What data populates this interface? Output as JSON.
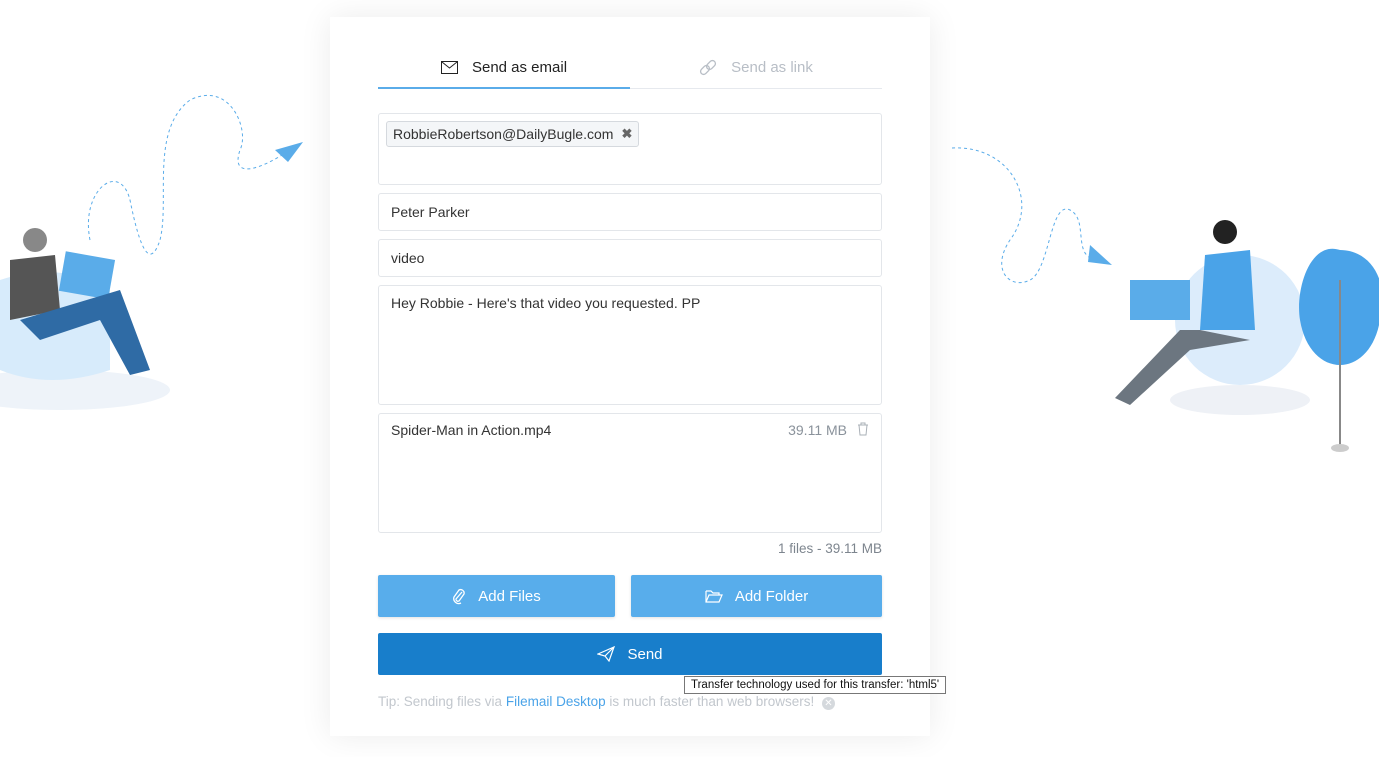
{
  "tabs": [
    {
      "label": "Send as email",
      "icon": "envelope-icon",
      "active": true
    },
    {
      "label": "Send as link",
      "icon": "link-icon",
      "active": false
    }
  ],
  "form": {
    "recipients": [
      "RobbieRobertson@DailyBugle.com"
    ],
    "from_name": "Peter Parker",
    "subject": "video",
    "message": "Hey Robbie - Here's that video you requested. PP"
  },
  "files": [
    {
      "name": "Spider-Man in Action.mp4",
      "size": "39.11 MB"
    }
  ],
  "summary": "1 files - 39.11 MB",
  "buttons": {
    "add_files": "Add Files",
    "add_folder": "Add Folder",
    "send": "Send"
  },
  "tooltip": "Transfer technology used for this transfer: 'html5'",
  "tip": {
    "prefix": "Tip: Sending files via",
    "link": "Filemail Desktop",
    "suffix": "is much faster than web browsers!"
  },
  "colors": {
    "accent": "#58adeb",
    "send": "#187ecb"
  }
}
